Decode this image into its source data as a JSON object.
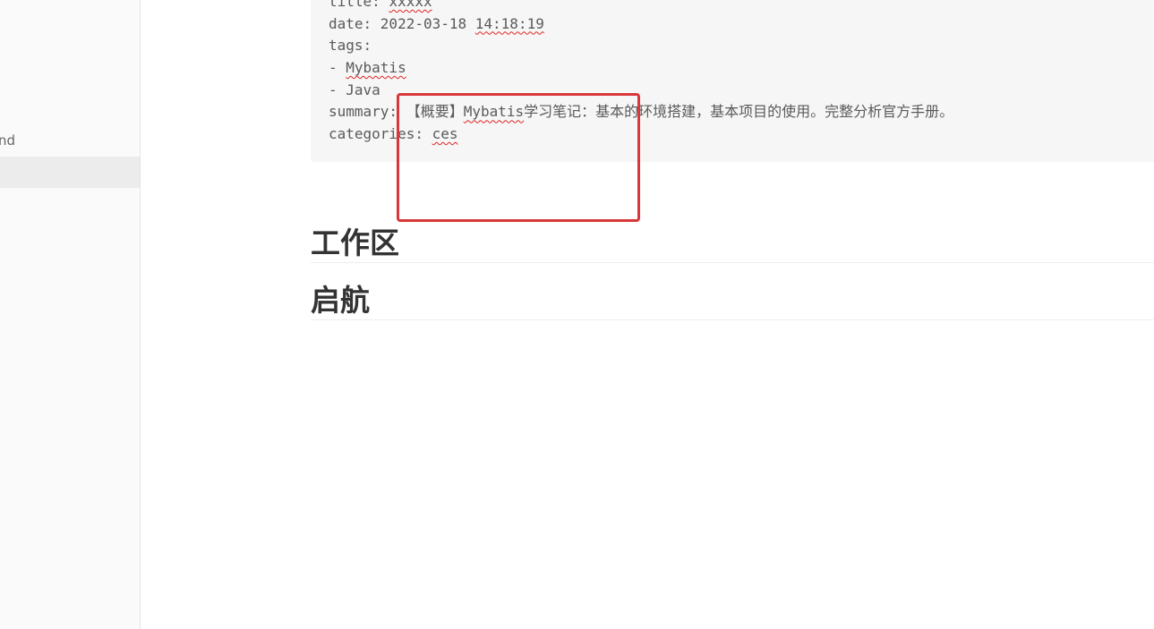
{
  "sidebar": {
    "items": [
      {
        "label": "nd"
      },
      {
        "label": ""
      }
    ]
  },
  "front_matter": {
    "title_line_prefix": "title: ",
    "title_value": "xxxxx",
    "date_prefix": "date: 2022-03-18 ",
    "date_time": "14:18:19",
    "tags_label": "tags:",
    "tag1_prefix": "- ",
    "tag1_value": "Mybatis",
    "tag2": "- Java",
    "summary_prefix": "summary: 【概要】",
    "summary_word": "Mybatis",
    "summary_rest": "学习笔记：基本的环境搭建，基本项目的使用。完整分析官方手册。",
    "categories_prefix": "categories: ",
    "categories_value": "ces"
  },
  "headings": [
    {
      "text": "工作区"
    },
    {
      "text": "启航"
    }
  ],
  "annotation": {
    "box_color": "#d9383a"
  }
}
